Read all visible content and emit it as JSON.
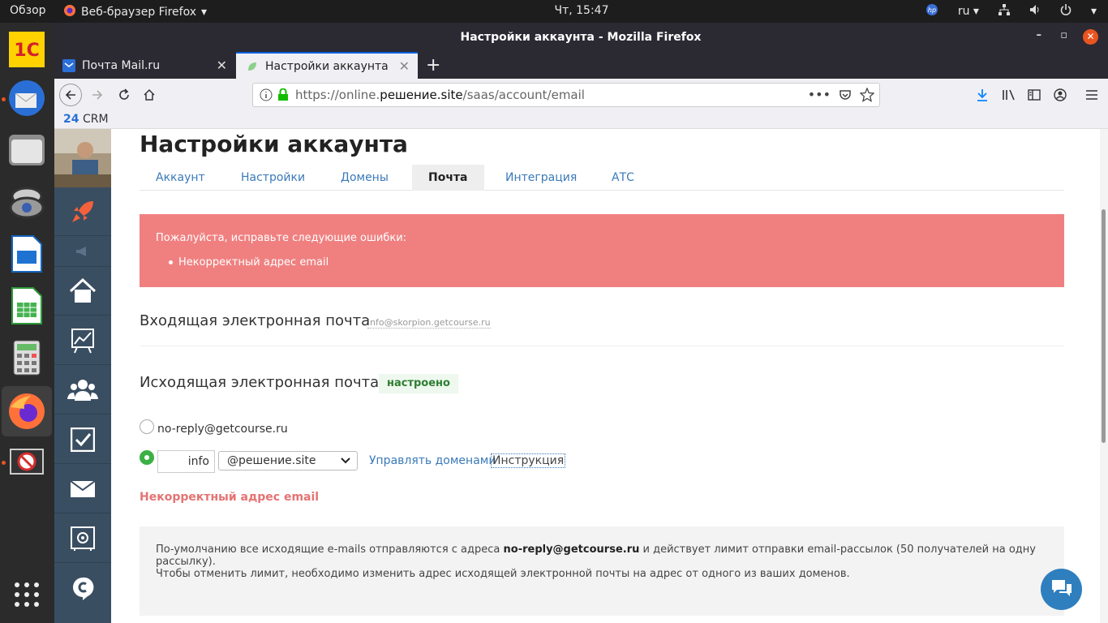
{
  "topbar": {
    "activities": "Обзор",
    "app": "Веб-браузер Firefox",
    "clock": "Чт, 15:47",
    "lang": "ru"
  },
  "window": {
    "title": "Настройки аккаунта - Mozilla Firefox"
  },
  "tabs": [
    {
      "label": "Почта Mail.ru"
    },
    {
      "label": "Настройки аккаунта"
    }
  ],
  "url": {
    "prefix": "https://online.",
    "domain": "решение.site",
    "path": "/saas/account/email"
  },
  "bookmarks": {
    "first": "CRM",
    "first_num": "24"
  },
  "page": {
    "title": "Настройки аккаунта",
    "nav": [
      "Аккаунт",
      "Настройки",
      "Домены",
      "Почта",
      "Интеграция",
      "АТС"
    ],
    "alert": {
      "title": "Пожалуйста, исправьте следующие ошибки:",
      "item": "Некорректный адрес email"
    },
    "incoming": {
      "title": "Входящая электронная почта",
      "address": "info@skorpion.getcourse.ru"
    },
    "outgoing": {
      "title": "Исходящая электронная почта",
      "status": "настроено"
    },
    "option1": "no-reply@getcourse.ru",
    "option2": {
      "local": "info",
      "domain": "@решение.site",
      "manage": "Управлять доменами",
      "instruction": "Инструкция"
    },
    "error": "Некорректный адрес email",
    "info": {
      "p1_a": "По-умолчанию все исходящие e-mails отправляются с адреса",
      "p1_b": "no-reply@getcourse.ru",
      "p1_c": "и действует лимит отправки email-рассылок (50 получателей на одну рассылку).",
      "p2": "Чтобы отменить лимит, необходимо изменить адрес исходящей электронной почты на адрес от одного из ваших доменов."
    }
  }
}
